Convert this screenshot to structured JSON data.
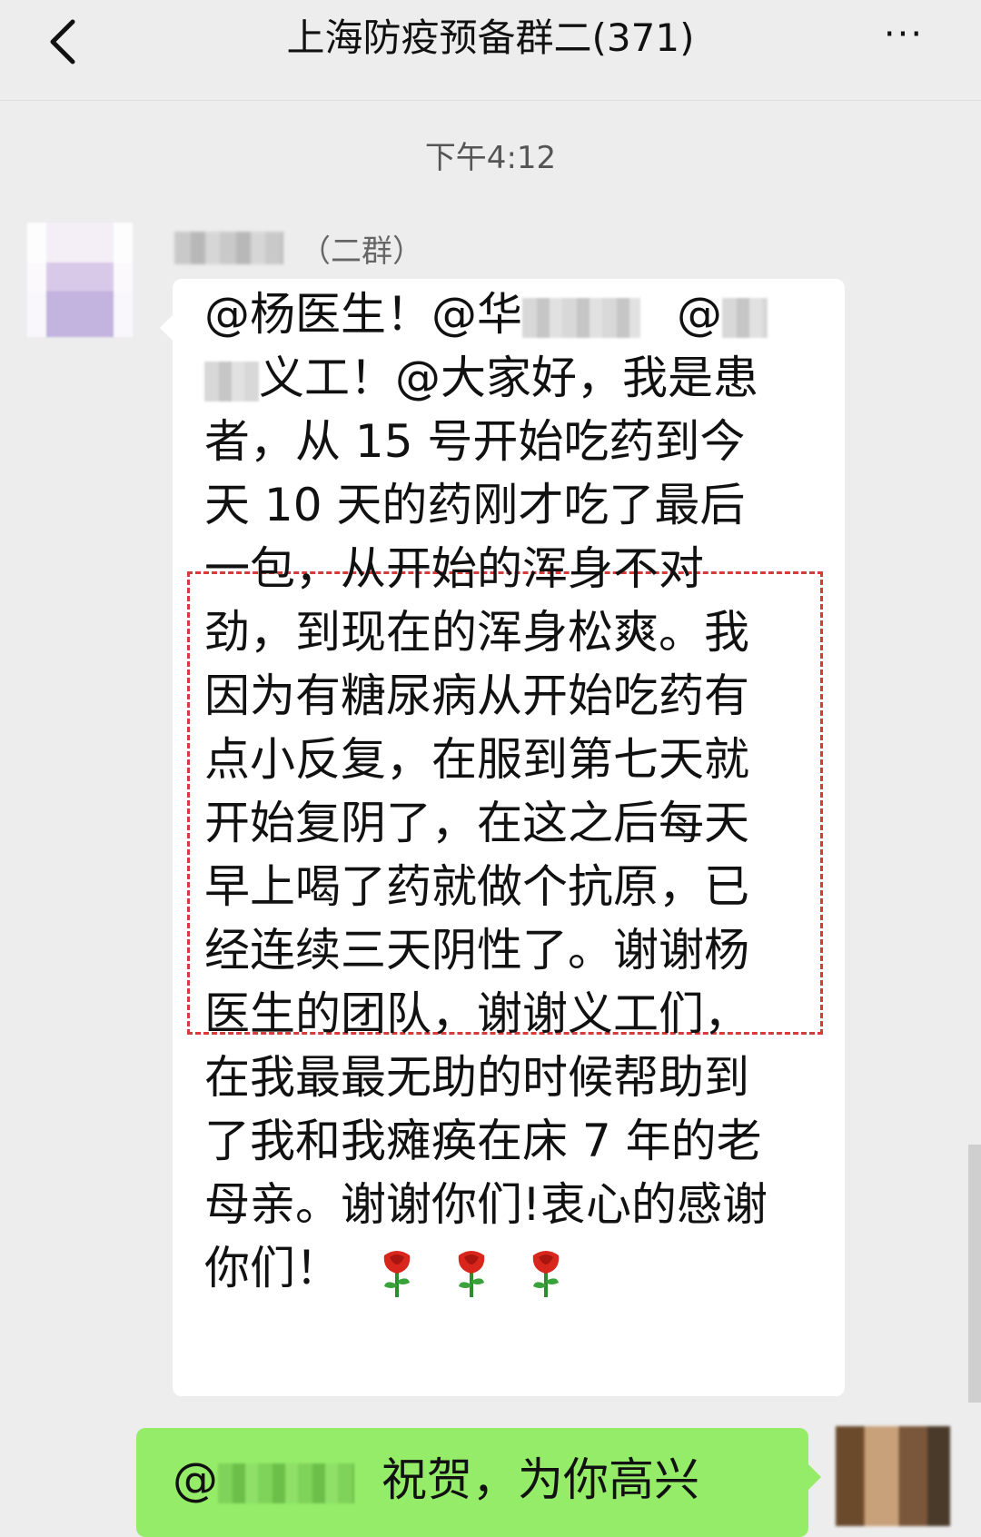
{
  "header": {
    "title": "上海防疫预备群二(371)",
    "more_label": "···"
  },
  "chat": {
    "time": "下午4:12",
    "message1": {
      "sender_suffix": "（二群）",
      "lines": [
        "@杨医生！@华",
        "义工！@大家好，我是患",
        "者，从 15 号开始吃药到今",
        "天 10 天的药刚才吃了最后",
        "一包，从开始的浑身不对",
        "劲，到现在的浑身松爽。我",
        "因为有糖尿病从开始吃药有",
        "点小反复，在服到第七天就",
        "开始复阴了，在这之后每天",
        "早上喝了药就做个抗原，已",
        "经连续三天阴性了。谢谢杨",
        "医生的团队，谢谢义工们，",
        "在我最最无助的时候帮助到",
        "了我和我瘫痪在床 7 年的老",
        "母亲。谢谢你们!衷心的感谢",
        "你们！"
      ],
      "line1_tail": "@",
      "emoji": "rose-icon"
    },
    "message2": {
      "prefix": "@",
      "text": "祝贺，为你高兴"
    }
  },
  "colors": {
    "background": "#ededed",
    "bubble_in": "#ffffff",
    "bubble_out": "#95ec69",
    "highlight": "#d63a3a"
  }
}
